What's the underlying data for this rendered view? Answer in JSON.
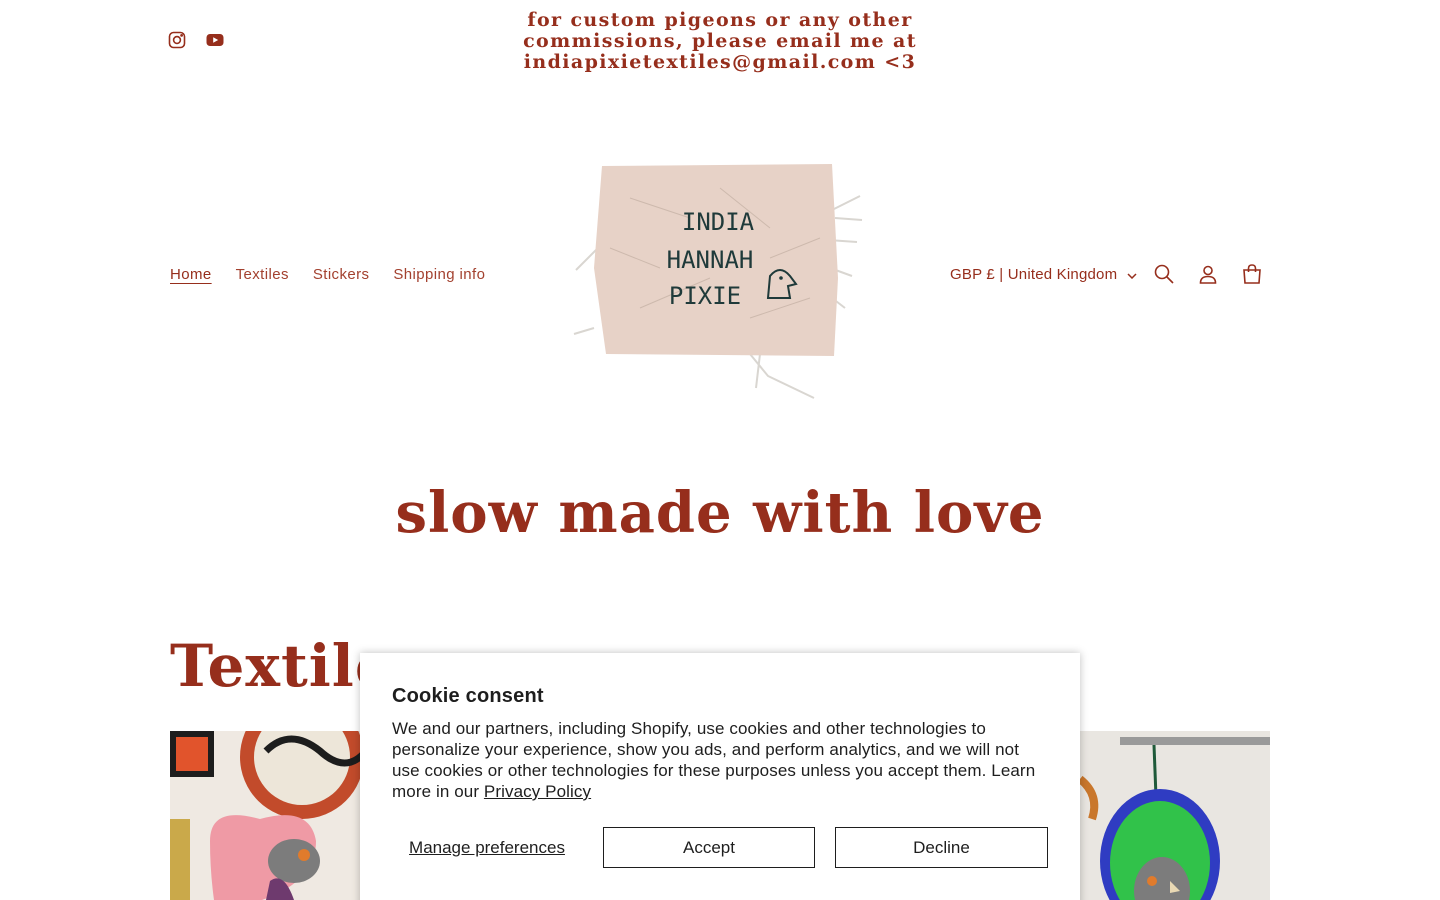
{
  "announcement": {
    "text": "for custom pigeons or any other commissions, please email me at indiapixietextiles@gmail.com <3"
  },
  "social": [
    {
      "icon": "instagram-icon"
    },
    {
      "icon": "youtube-icon"
    }
  ],
  "logo": {
    "lines": [
      "INDIA",
      "HANNAH",
      "PIXIE"
    ]
  },
  "nav": {
    "items": [
      {
        "label": "Home",
        "active": true
      },
      {
        "label": "Textiles",
        "active": false
      },
      {
        "label": "Stickers",
        "active": false
      },
      {
        "label": "Shipping info",
        "active": false
      }
    ]
  },
  "header": {
    "country_selector": "GBP £ | United Kingdom",
    "icons": [
      "search-icon",
      "account-icon",
      "cart-icon"
    ]
  },
  "hero": {
    "title": "slow made with love"
  },
  "section": {
    "title": "Textiles"
  },
  "cookie": {
    "title": "Cookie consent",
    "body": "We and our partners, including Shopify, use cookies and other technologies to personalize your experience, show you ads, and perform analytics, and we will not use cookies or other technologies for these purposes unless you accept them. Learn more in our ",
    "link": "Privacy Policy",
    "manage_label": "Manage preferences",
    "accept_label": "Accept",
    "decline_label": "Decline"
  },
  "colors": {
    "brand": "#962e1c",
    "text_dark": "#1e1e1e",
    "background": "#ffffff"
  }
}
